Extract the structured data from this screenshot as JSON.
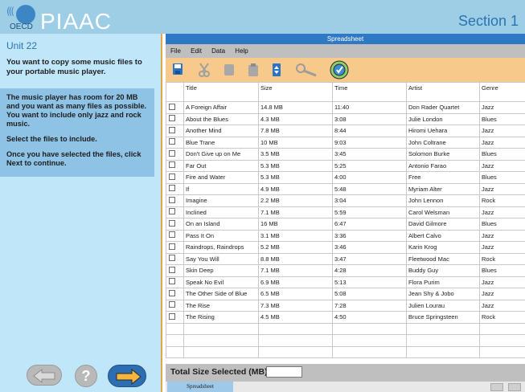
{
  "header": {
    "logo_small": "OECD",
    "logo_text": "PIAAC",
    "section": "Section 1"
  },
  "left_panel": {
    "unit": "Unit 22",
    "task": "You want to copy some music files to your portable music player.",
    "instructions": [
      "The music player has room for 20 MB and you want as many files as possible. You want to include only jazz and rock music.",
      "Select the files to include.",
      "Once you have selected the files, click Next to continue."
    ],
    "nav": {
      "back_icon": "left-arrow-icon",
      "help_label": "?",
      "next_icon": "right-arrow-icon"
    }
  },
  "spreadsheet": {
    "title": "Spreadsheet",
    "menu": [
      "File",
      "Edit",
      "Data",
      "Help"
    ],
    "toolbar_icons": [
      "save-icon",
      "cut-icon",
      "copy-icon",
      "paste-icon",
      "sort-icon",
      "search-icon",
      "chart-icon"
    ],
    "columns": [
      "Title",
      "Size",
      "Time",
      "Artist",
      "Genre"
    ],
    "rows": [
      [
        "A Foreign Affair",
        "14.8 MB",
        "11:40",
        "Don Rader Quartet",
        "Jazz"
      ],
      [
        "About the Blues",
        "4.3 MB",
        "3:08",
        "Julie London",
        "Blues"
      ],
      [
        "Another Mind",
        "7.8 MB",
        "8:44",
        "Hiromi Uehara",
        "Jazz"
      ],
      [
        "Blue Trane",
        "10 MB",
        "9:03",
        "John Coltrane",
        "Jazz"
      ],
      [
        "Don't Give up on Me",
        "3.5 MB",
        "3:45",
        "Solomon Burke",
        "Blues"
      ],
      [
        "Far Out",
        "5.3 MB",
        "5:25",
        "Antonio Farao",
        "Jazz"
      ],
      [
        "Fire and Water",
        "5.3 MB",
        "4:00",
        "Free",
        "Blues"
      ],
      [
        "If",
        "4.9 MB",
        "5:48",
        "Myriam Alter",
        "Jazz"
      ],
      [
        "Imagine",
        "2.2 MB",
        "3:04",
        "John Lennon",
        "Rock"
      ],
      [
        "Inclined",
        "7.1 MB",
        "5:59",
        "Carol Welsman",
        "Jazz"
      ],
      [
        "On an Island",
        "16 MB",
        "6:47",
        "David Gilmore",
        "Blues"
      ],
      [
        "Pass It On",
        "3.1 MB",
        "3:36",
        "Albert Calvo",
        "Jazz"
      ],
      [
        "Raindrops, Raindrops",
        "5.2 MB",
        "3:46",
        "Karin Krog",
        "Jazz"
      ],
      [
        "Say You Will",
        "8.8 MB",
        "3:47",
        "Fleetwood Mac",
        "Rock"
      ],
      [
        "Skin Deep",
        "7.1 MB",
        "4:28",
        "Buddy Guy",
        "Blues"
      ],
      [
        "Speak No Evil",
        "6.9 MB",
        "5:13",
        "Flora Purim",
        "Jazz"
      ],
      [
        "The Other Side of Blue",
        "6.5 MB",
        "5:08",
        "Jean Shy & Jobo",
        "Jazz"
      ],
      [
        "The Rise",
        "7.3 MB",
        "7:28",
        "Julien Lourau",
        "Jazz"
      ],
      [
        "The Rising",
        "4.5 MB",
        "4:50",
        "Bruce Springsteen",
        "Rock"
      ]
    ],
    "total_label": "Total Size Selected (MB)",
    "total_value": "",
    "tab": "Spreadsheet"
  },
  "colors": {
    "header_bg": "#9ecde6",
    "left_panel_bg": "#bfe6f9",
    "instructions_bg": "#8ec3e6",
    "title_bar": "#2f78c4",
    "toolbar_bg": "#f7c98b",
    "next_button": "#2d6eb3",
    "accent_border": "#e6a640"
  }
}
